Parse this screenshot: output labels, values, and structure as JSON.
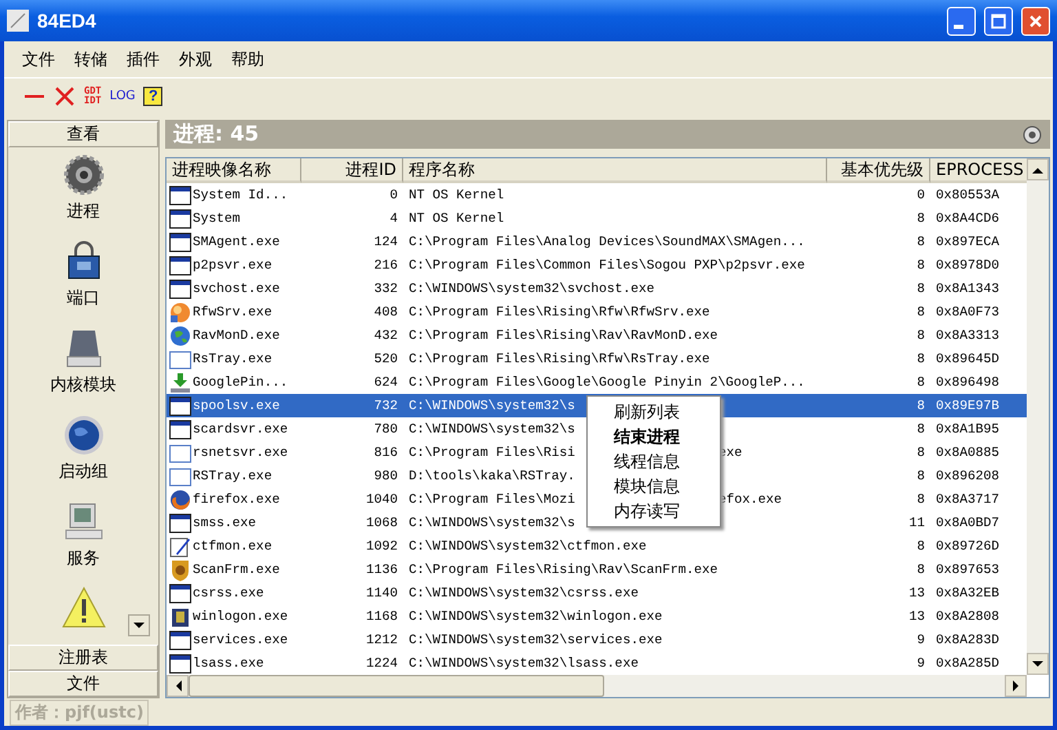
{
  "window": {
    "title": "84ED4"
  },
  "menu_bar": [
    "文件",
    "转储",
    "插件",
    "外观",
    "帮助"
  ],
  "toolbar": {
    "gdt_idt": [
      "GDT",
      "IDT"
    ],
    "log": "LOG",
    "help": "?"
  },
  "sidebar": {
    "header": "查看",
    "items": [
      {
        "label": "进程"
      },
      {
        "label": "端口"
      },
      {
        "label": "内核模块"
      },
      {
        "label": "启动组"
      },
      {
        "label": "服务"
      }
    ],
    "footer_tabs": [
      "注册表",
      "文件"
    ]
  },
  "panel": {
    "title": "进程: 45"
  },
  "table": {
    "columns": [
      "进程映像名称",
      "进程ID",
      "程序名称",
      "基本优先级",
      "EPROCESS"
    ],
    "rows": [
      {
        "name": "System Id...",
        "pid": "0",
        "path": "NT OS Kernel",
        "priority": "0",
        "eprocess": "0x80553A",
        "selected": false
      },
      {
        "name": "System",
        "pid": "4",
        "path": "NT OS Kernel",
        "priority": "8",
        "eprocess": "0x8A4CD6",
        "selected": false
      },
      {
        "name": "SMAgent.exe",
        "pid": "124",
        "path": "C:\\Program Files\\Analog Devices\\SoundMAX\\SMAgen...",
        "priority": "8",
        "eprocess": "0x897ECA",
        "selected": false
      },
      {
        "name": "p2psvr.exe",
        "pid": "216",
        "path": "C:\\Program Files\\Common Files\\Sogou PXP\\p2psvr.exe",
        "priority": "8",
        "eprocess": "0x8978D0",
        "selected": false
      },
      {
        "name": "svchost.exe",
        "pid": "332",
        "path": "C:\\WINDOWS\\system32\\svchost.exe",
        "priority": "8",
        "eprocess": "0x8A1343",
        "selected": false
      },
      {
        "name": "RfwSrv.exe",
        "pid": "408",
        "path": "C:\\Program Files\\Rising\\Rfw\\RfwSrv.exe",
        "priority": "8",
        "eprocess": "0x8A0F73",
        "selected": false
      },
      {
        "name": "RavMonD.exe",
        "pid": "432",
        "path": "C:\\Program Files\\Rising\\Rav\\RavMonD.exe",
        "priority": "8",
        "eprocess": "0x8A3313",
        "selected": false
      },
      {
        "name": "RsTray.exe",
        "pid": "520",
        "path": "C:\\Program Files\\Rising\\Rfw\\RsTray.exe",
        "priority": "8",
        "eprocess": "0x89645D",
        "selected": false
      },
      {
        "name": "GooglePin...",
        "pid": "624",
        "path": "C:\\Program Files\\Google\\Google Pinyin 2\\GoogleP...",
        "priority": "8",
        "eprocess": "0x896498",
        "selected": false
      },
      {
        "name": "spoolsv.exe",
        "pid": "732",
        "path": "C:\\WINDOWS\\system32\\s",
        "priority": "8",
        "eprocess": "0x89E97B",
        "selected": true
      },
      {
        "name": "scardsvr.exe",
        "pid": "780",
        "path": "C:\\WINDOWS\\system32\\s",
        "priority": "8",
        "eprocess": "0x8A1B95",
        "selected": false
      },
      {
        "name": "rsnetsvr.exe",
        "pid": "816",
        "path": "C:\\Program Files\\Risi",
        "path_tail": "exe",
        "priority": "8",
        "eprocess": "0x8A0885",
        "selected": false
      },
      {
        "name": "RSTray.exe",
        "pid": "980",
        "path": "D:\\tools\\kaka\\RSTray.",
        "priority": "8",
        "eprocess": "0x896208",
        "selected": false
      },
      {
        "name": "firefox.exe",
        "pid": "1040",
        "path": "C:\\Program Files\\Mozi",
        "path_tail": "efox.exe",
        "priority": "8",
        "eprocess": "0x8A3717",
        "selected": false
      },
      {
        "name": "smss.exe",
        "pid": "1068",
        "path": "C:\\WINDOWS\\system32\\s",
        "priority": "11",
        "eprocess": "0x8A0BD7",
        "selected": false
      },
      {
        "name": "ctfmon.exe",
        "pid": "1092",
        "path": "C:\\WINDOWS\\system32\\ctfmon.exe",
        "priority": "8",
        "eprocess": "0x89726D",
        "selected": false
      },
      {
        "name": "ScanFrm.exe",
        "pid": "1136",
        "path": "C:\\Program Files\\Rising\\Rav\\ScanFrm.exe",
        "priority": "8",
        "eprocess": "0x897653",
        "selected": false
      },
      {
        "name": "csrss.exe",
        "pid": "1140",
        "path": "C:\\WINDOWS\\system32\\csrss.exe",
        "priority": "13",
        "eprocess": "0x8A32EB",
        "selected": false
      },
      {
        "name": "winlogon.exe",
        "pid": "1168",
        "path": "C:\\WINDOWS\\system32\\winlogon.exe",
        "priority": "13",
        "eprocess": "0x8A2808",
        "selected": false
      },
      {
        "name": "services.exe",
        "pid": "1212",
        "path": "C:\\WINDOWS\\system32\\services.exe",
        "priority": "9",
        "eprocess": "0x8A283D",
        "selected": false
      },
      {
        "name": "lsass.exe",
        "pid": "1224",
        "path": "C:\\WINDOWS\\system32\\lsass.exe",
        "priority": "9",
        "eprocess": "0x8A285D",
        "selected": false
      }
    ]
  },
  "context_menu": [
    {
      "label": "刷新列表",
      "default": false
    },
    {
      "label": "结束进程",
      "default": true
    },
    {
      "label": "线程信息",
      "default": false
    },
    {
      "label": "模块信息",
      "default": false
    },
    {
      "label": "内存读写",
      "default": false
    }
  ],
  "status_bar": {
    "text": "作者：pjf(ustc)"
  }
}
